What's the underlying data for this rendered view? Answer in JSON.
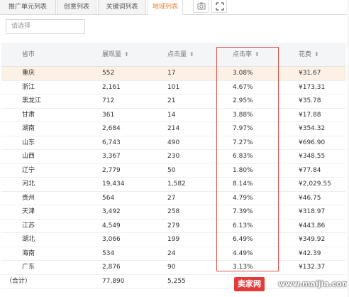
{
  "tabs": [
    {
      "label": "推广单元列表",
      "active": false
    },
    {
      "label": "创意列表",
      "active": false
    },
    {
      "label": "关键词列表",
      "active": false
    },
    {
      "label": "地域列表",
      "active": true
    }
  ],
  "toolbar": {
    "icons": [
      "camera-icon",
      "expand-icon"
    ]
  },
  "filter": {
    "placeholder": "请选择"
  },
  "table": {
    "headers": [
      "省市",
      "展现量",
      "点击量",
      "点击率",
      "花费"
    ],
    "sortable": [
      false,
      true,
      true,
      true,
      true
    ],
    "rows": [
      [
        "重庆",
        "552",
        "17",
        "3.08%",
        "¥31.67"
      ],
      [
        "浙江",
        "2,161",
        "101",
        "4.67%",
        "¥173.31"
      ],
      [
        "黑龙江",
        "712",
        "21",
        "2.95%",
        "¥35.78"
      ],
      [
        "甘肃",
        "361",
        "14",
        "3.88%",
        "¥17.88"
      ],
      [
        "湖南",
        "2,684",
        "214",
        "7.97%",
        "¥354.32"
      ],
      [
        "山东",
        "6,743",
        "490",
        "7.27%",
        "¥696.90"
      ],
      [
        "山西",
        "3,367",
        "230",
        "6.83%",
        "¥348.55"
      ],
      [
        "辽宁",
        "2,779",
        "50",
        "1.80%",
        "¥77.84"
      ],
      [
        "河北",
        "19,434",
        "1,582",
        "8.14%",
        "¥2,029.55"
      ],
      [
        "贵州",
        "564",
        "27",
        "4.79%",
        "¥46.75"
      ],
      [
        "天津",
        "3,492",
        "258",
        "7.39%",
        "¥318.97"
      ],
      [
        "江苏",
        "4,549",
        "279",
        "6.13%",
        "¥443.86"
      ],
      [
        "湖北",
        "3,066",
        "199",
        "6.49%",
        "¥349.92"
      ],
      [
        "海南",
        "534",
        "24",
        "4.49%",
        "¥42.39"
      ],
      [
        "广东",
        "2,876",
        "90",
        "3.13%",
        "¥132.37"
      ]
    ],
    "total": [
      "（合计）",
      "77,890",
      "5,255",
      "",
      ""
    ]
  },
  "highlight_color": "#d9534f",
  "accent_color": "#e8823a",
  "watermark": {
    "badge": "卖家网",
    "url": "www.maijia.com"
  }
}
